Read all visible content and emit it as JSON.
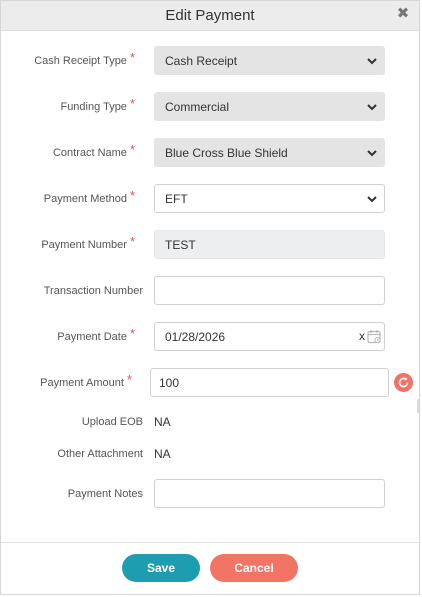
{
  "dialog": {
    "title": "Edit Payment",
    "close_symbol": "✖"
  },
  "form": {
    "cash_receipt_type": {
      "label": "Cash Receipt Type",
      "value": "Cash Receipt",
      "required_mark": "*"
    },
    "funding_type": {
      "label": "Funding Type",
      "value": "Commercial",
      "required_mark": "*"
    },
    "contract_name": {
      "label": "Contract Name",
      "value": "Blue Cross Blue Shield",
      "required_mark": "*"
    },
    "payment_method": {
      "label": "Payment Method",
      "value": "EFT",
      "required_mark": "*"
    },
    "payment_number": {
      "label": "Payment Number",
      "value": "TEST",
      "required_mark": "*"
    },
    "transaction_number": {
      "label": "Transaction Number",
      "value": ""
    },
    "payment_date": {
      "label": "Payment Date",
      "value": "01/28/2026",
      "clear_symbol": "x",
      "required_mark": "*"
    },
    "payment_amount": {
      "label": "Payment Amount",
      "value": "100",
      "required_mark": "*"
    },
    "upload_eob": {
      "label": "Upload EOB",
      "value": "NA"
    },
    "other_attachment": {
      "label": "Other Attachment",
      "value": "NA"
    },
    "payment_notes": {
      "label": "Payment Notes",
      "value": ""
    }
  },
  "buttons": {
    "save": "Save",
    "cancel": "Cancel"
  },
  "colors": {
    "save_bg": "#1e9db0",
    "cancel_bg": "#f17465",
    "required": "#e05252",
    "refresh_bg": "#f07365"
  },
  "icons": {
    "close": "close-icon",
    "dropdown": "chevron-down-icon",
    "calendar": "calendar-icon",
    "refresh": "refresh-icon"
  }
}
